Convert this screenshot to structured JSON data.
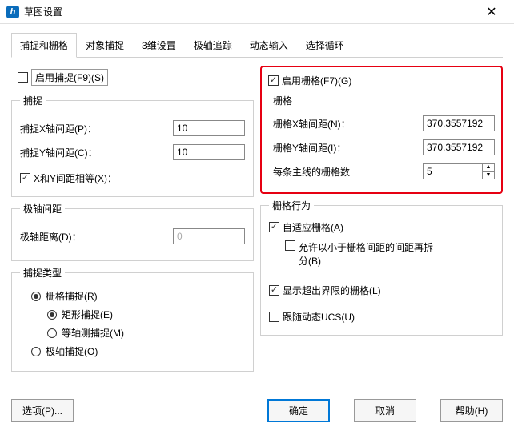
{
  "window": {
    "title": "草图设置",
    "icon_letter": "h"
  },
  "tabs": [
    "捕捉和栅格",
    "对象捕捉",
    "3维设置",
    "极轴追踪",
    "动态输入",
    "选择循环"
  ],
  "left": {
    "enable_snap": "启用捕捉(F9)(S)",
    "snap_group": "捕捉",
    "snap_x_label": "捕捉X轴间距(P)：",
    "snap_x_value": "10",
    "snap_y_label": "捕捉Y轴间距(C)：",
    "snap_y_value": "10",
    "equal_xy": "X和Y间距相等(X)：",
    "polar_group": "极轴间距",
    "polar_dist_label": "极轴距离(D)：",
    "polar_dist_value": "0",
    "snap_type_group": "捕捉类型",
    "grid_snap": "栅格捕捉(R)",
    "rect_snap": "矩形捕捉(E)",
    "iso_snap": "等轴测捕捉(M)",
    "polar_snap": "极轴捕捉(O)"
  },
  "right": {
    "enable_grid": "启用栅格(F7)(G)",
    "grid_group": "栅格",
    "grid_x_label": "栅格X轴间距(N)：",
    "grid_x_value": "370.3557192",
    "grid_y_label": "栅格Y轴间距(I)：",
    "grid_y_value": "370.3557192",
    "major_lines_label": "每条主线的栅格数",
    "major_lines_value": "5",
    "behavior_group": "栅格行为",
    "adaptive": "自适应栅格(A)",
    "allow_sub": "允许以小于栅格间距的间距再拆分(B)",
    "show_beyond": "显示超出界限的栅格(L)",
    "follow_ucs": "跟随动态UCS(U)"
  },
  "buttons": {
    "options": "选项(P)...",
    "ok": "确定",
    "cancel": "取消",
    "help": "帮助(H)"
  }
}
